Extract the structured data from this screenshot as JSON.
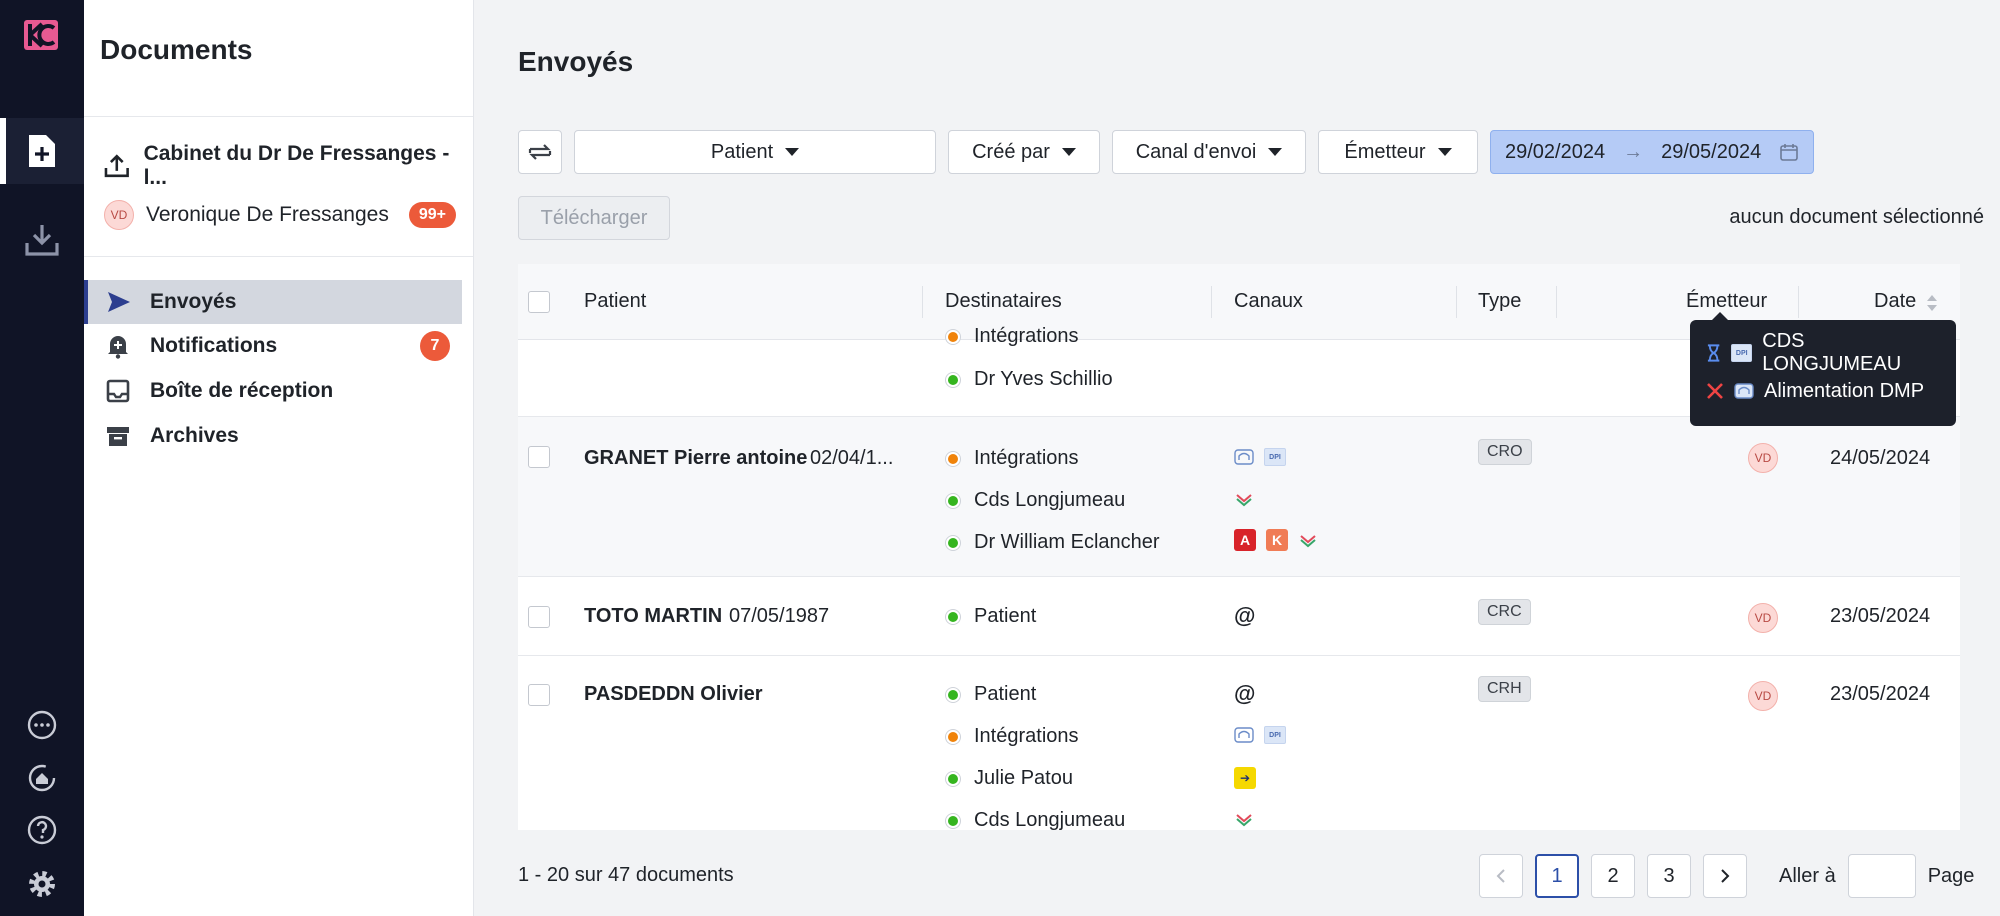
{
  "sidebar": {
    "title": "Documents",
    "org": "Cabinet du Dr De Fressanges - l...",
    "user": {
      "initials": "VD",
      "name": "Veronique De Fressanges",
      "badge": "99+"
    },
    "nav": [
      {
        "label": "Envoyés",
        "icon": "send-icon",
        "active": true
      },
      {
        "label": "Notifications",
        "icon": "bell-icon",
        "count": "7"
      },
      {
        "label": "Boîte de réception",
        "icon": "inbox-icon"
      },
      {
        "label": "Archives",
        "icon": "archive-icon"
      }
    ]
  },
  "main": {
    "title": "Envoyés",
    "filters": {
      "patient": "Patient",
      "created_by": "Créé par",
      "channel": "Canal d'envoi",
      "sender": "Émetteur",
      "date_from": "29/02/2024",
      "date_to": "29/05/2024"
    },
    "download_label": "Télécharger",
    "selection_info": "aucun document sélectionné",
    "columns": {
      "patient": "Patient",
      "recipients": "Destinataires",
      "channels": "Canaux",
      "type": "Type",
      "sender": "Émetteur",
      "date": "Date"
    },
    "partial_row": {
      "recipients": [
        "Intégrations",
        "Dr Yves Schillio"
      ]
    },
    "rows": [
      {
        "name": "GRANET Pierre antoine",
        "dob": "02/04/1...",
        "recipients": [
          "Intégrations",
          "Cds Longjumeau",
          "Dr William Eclancher"
        ],
        "type": "CRO",
        "sender": "VD",
        "date": "24/05/2024"
      },
      {
        "name": "TOTO MARTIN",
        "dob": "07/05/1987",
        "recipients": [
          "Patient"
        ],
        "type": "CRC",
        "sender": "VD",
        "date": "23/05/2024"
      },
      {
        "name": "PASDEDDN Olivier",
        "dob": "",
        "recipients": [
          "Patient",
          "Intégrations",
          "Julie Patou",
          "Cds Longjumeau"
        ],
        "type": "CRH",
        "sender": "VD",
        "date": "23/05/2024"
      }
    ],
    "tooltip": {
      "line1": "CDS LONGJUMEAU",
      "line2": "Alimentation DMP"
    },
    "footer": {
      "count": "1 - 20 sur 47 documents",
      "pages": [
        "1",
        "2",
        "3"
      ],
      "goto_label": "Aller à",
      "page_label": "Page"
    }
  },
  "colors": {
    "rail_bg": "#101426",
    "accent": "#2c3e8f",
    "badge": "#ec5a3a",
    "status_green": "#35b51f",
    "status_orange": "#f0830a"
  }
}
